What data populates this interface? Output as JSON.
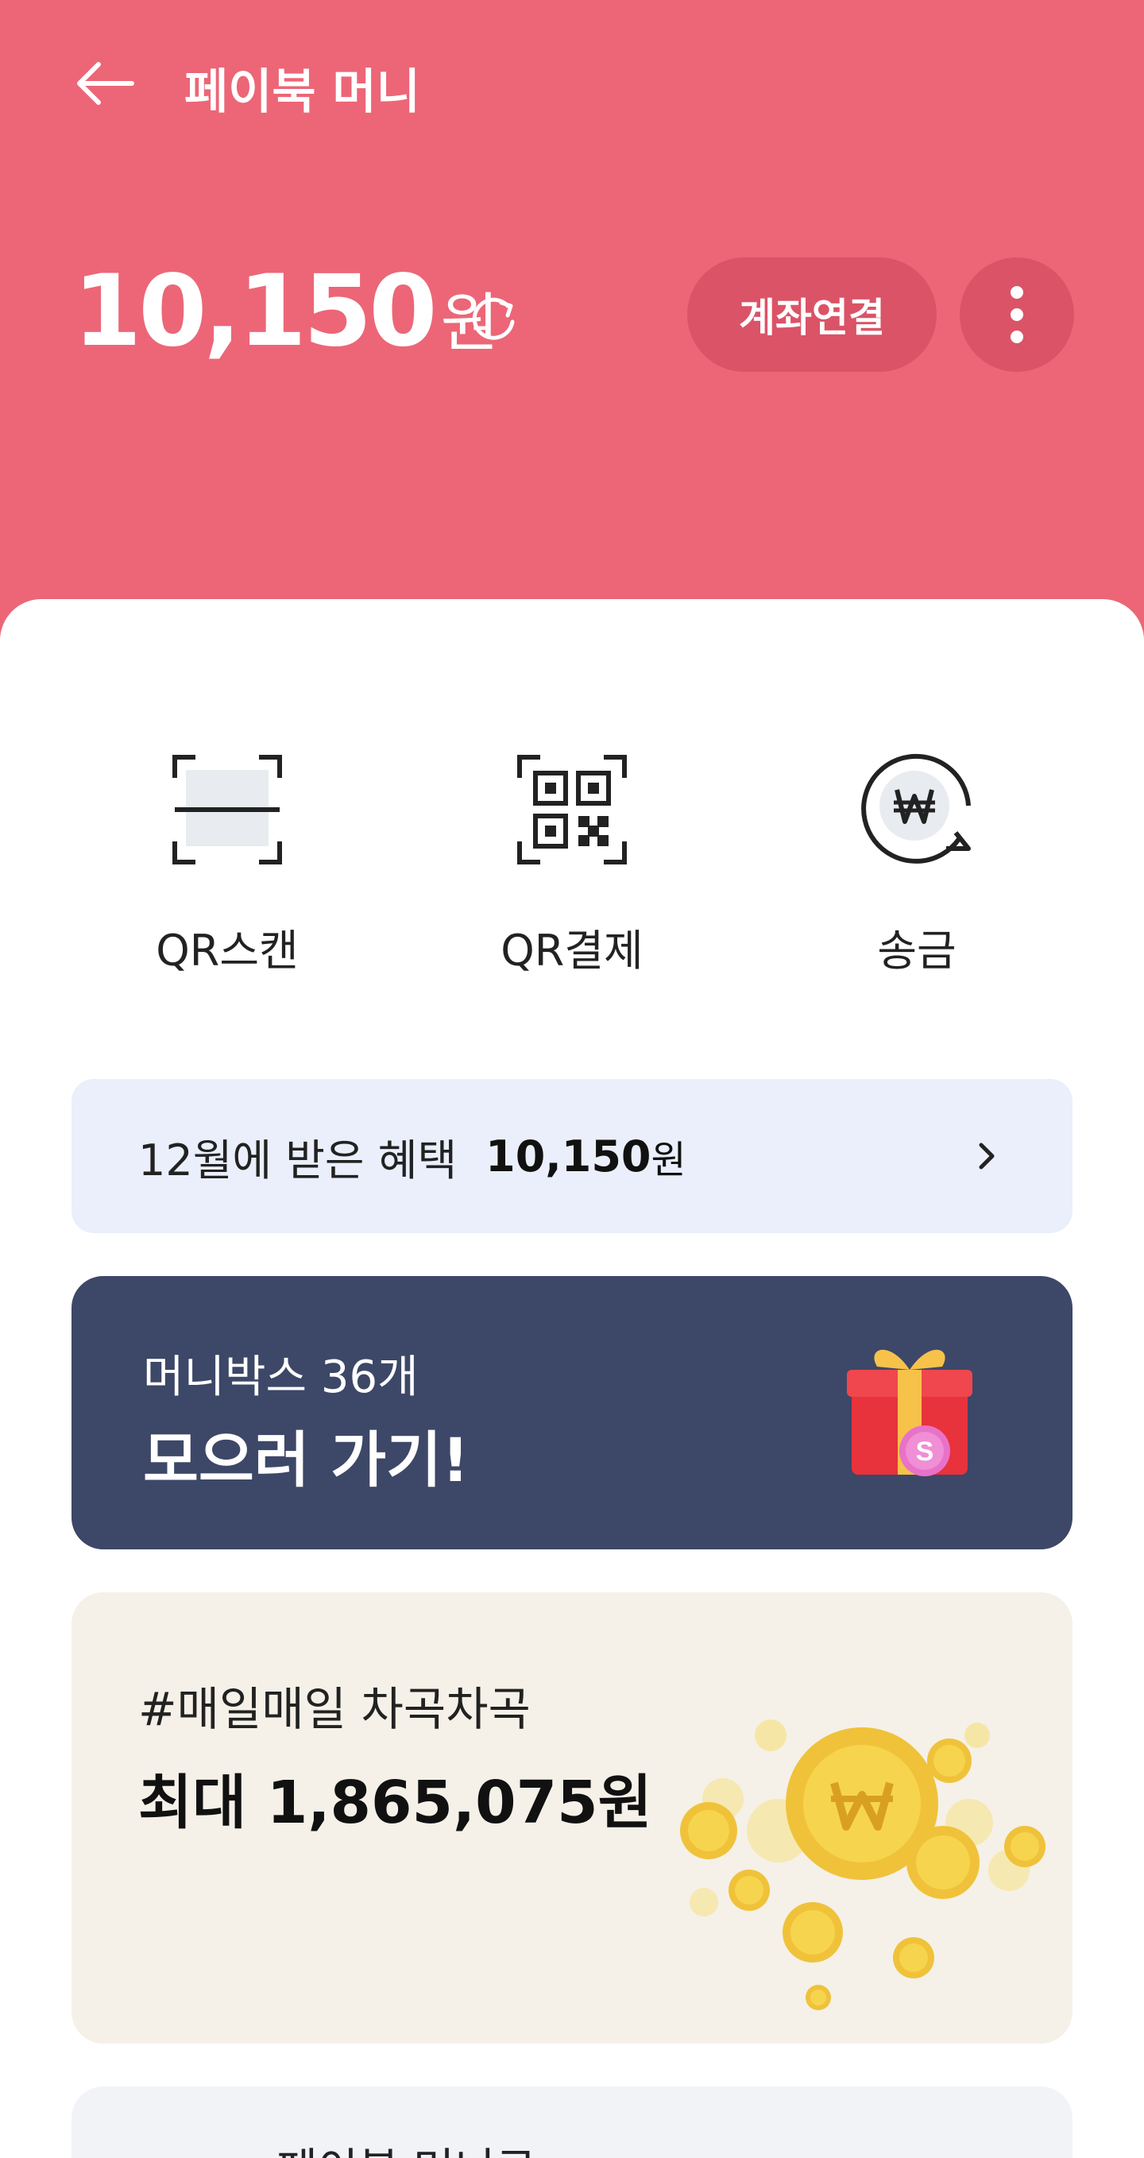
{
  "theme": {
    "brand": "#ec6677",
    "moneybox_bg": "#3d4767",
    "benefit_bg": "#eaeffb",
    "daily_bg": "#f5f1e8"
  },
  "header": {
    "back_icon": "arrow-left-icon",
    "title": "페이북 머니",
    "balance": "10,150",
    "balance_unit": "원",
    "refresh_icon": "refresh-icon",
    "link_account": "계좌연결",
    "more_icon": "more-vertical-icon"
  },
  "actions": [
    {
      "label": "QR스캔",
      "icon": "qr-scan-icon"
    },
    {
      "label": "QR결제",
      "icon": "qr-code-icon"
    },
    {
      "label": "송금",
      "icon": "won-transfer-icon"
    }
  ],
  "benefit": {
    "label": "12월에 받은 혜택",
    "amount": "10,150",
    "unit": "원",
    "chevron_icon": "chevron-right-icon"
  },
  "moneybox": {
    "subtitle": "머니박스 36개",
    "title": "모으러 가기!",
    "icon": "gift-box-icon"
  },
  "daily": {
    "subtitle": "#매일매일 차곡차곡",
    "title": "최대 1,865,075원",
    "icon": "gold-coins-icon"
  },
  "peek": {
    "text": "페이북 머니로"
  }
}
